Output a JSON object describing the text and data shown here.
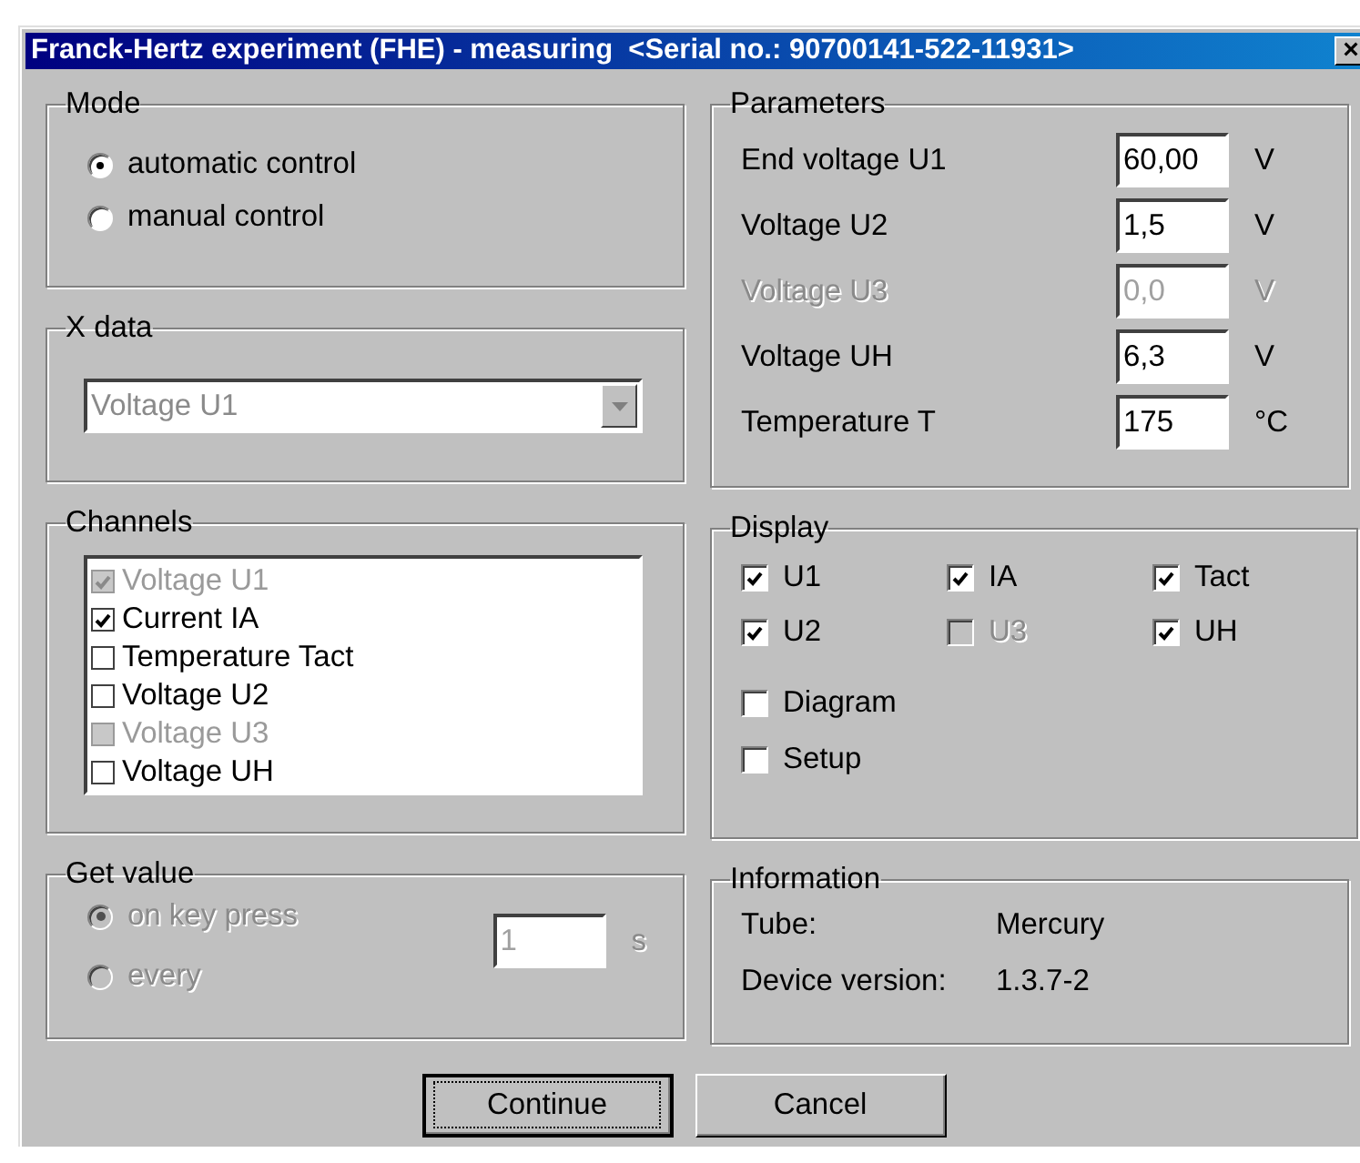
{
  "window": {
    "title": "Franck-Hertz experiment (FHE) - measuring  <Serial no.: 90700141-522-11931>",
    "close": "×"
  },
  "mode": {
    "title": "Mode",
    "options": [
      {
        "label": "automatic control",
        "selected": true,
        "disabled": false
      },
      {
        "label": "manual control",
        "selected": false,
        "disabled": false
      }
    ]
  },
  "x_data": {
    "title": "X data",
    "value": "Voltage U1",
    "disabled": true
  },
  "channels": {
    "title": "Channels",
    "items": [
      {
        "label": "Voltage U1",
        "checked": true,
        "disabled": true
      },
      {
        "label": "Current IA",
        "checked": true,
        "disabled": false
      },
      {
        "label": "Temperature Tact",
        "checked": false,
        "disabled": false
      },
      {
        "label": "Voltage U2",
        "checked": false,
        "disabled": false
      },
      {
        "label": "Voltage U3",
        "checked": false,
        "disabled": true
      },
      {
        "label": "Voltage UH",
        "checked": false,
        "disabled": false
      }
    ]
  },
  "get_value": {
    "title": "Get value",
    "options": [
      {
        "label": "on key press",
        "selected": true,
        "disabled": true
      },
      {
        "label": "every",
        "selected": false,
        "disabled": true
      }
    ],
    "interval": {
      "value": "1",
      "unit": "s",
      "disabled": true
    }
  },
  "parameters": {
    "title": "Parameters",
    "rows": [
      {
        "label": "End voltage U1",
        "value": "60,00",
        "unit": "V",
        "disabled": false
      },
      {
        "label": "Voltage U2",
        "value": "1,5",
        "unit": "V",
        "disabled": false
      },
      {
        "label": "Voltage U3",
        "value": "0,0",
        "unit": "V",
        "disabled": true
      },
      {
        "label": "Voltage UH",
        "value": "6,3",
        "unit": "V",
        "disabled": false
      },
      {
        "label": "Temperature T",
        "value": "175",
        "unit": "°C",
        "disabled": false
      }
    ]
  },
  "display": {
    "title": "Display",
    "items": [
      {
        "label": "U1",
        "checked": true,
        "disabled": false
      },
      {
        "label": "IA",
        "checked": true,
        "disabled": false
      },
      {
        "label": "Tact",
        "checked": true,
        "disabled": false
      },
      {
        "label": "U2",
        "checked": true,
        "disabled": false
      },
      {
        "label": "U3",
        "checked": false,
        "disabled": true
      },
      {
        "label": "UH",
        "checked": true,
        "disabled": false
      }
    ],
    "extras": [
      {
        "label": "Diagram",
        "checked": false
      },
      {
        "label": "Setup",
        "checked": false
      }
    ]
  },
  "information": {
    "title": "Information",
    "rows": [
      {
        "label": "Tube:",
        "value": "Mercury"
      },
      {
        "label": "Device version:",
        "value": "1.3.7-2"
      }
    ]
  },
  "buttons": [
    {
      "label": "Continue",
      "focused": true
    },
    {
      "label": "Cancel",
      "focused": false
    }
  ]
}
